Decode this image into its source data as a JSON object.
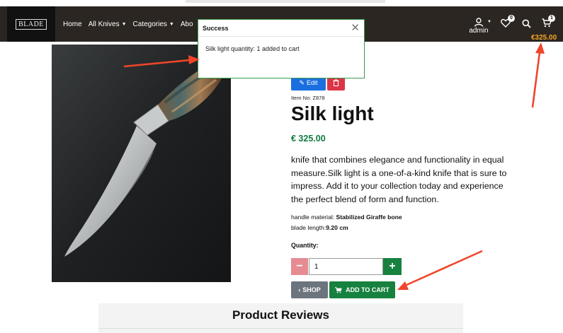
{
  "nav": {
    "logo": "BLADE",
    "links": [
      {
        "label": "Home",
        "dropdown": false
      },
      {
        "label": "All Knives",
        "dropdown": true
      },
      {
        "label": "Categories",
        "dropdown": true
      },
      {
        "label": "Abo",
        "dropdown": false
      }
    ],
    "user_label": "admin",
    "wishlist_count": "0",
    "cart_count": "1",
    "cart_total": "€325.00"
  },
  "toast": {
    "title": "Success",
    "message": "Silk light quantity: 1 added to cart"
  },
  "product": {
    "edit_label": "Edit",
    "item_no": "Item No: Z878",
    "title": "Silk light",
    "price": "€ 325.00",
    "description": "knife that combines elegance and functionality in equal measure.Silk light is a one-of-a-kind knife that is sure to impress. Add it to your collection today and experience the perfect blend of form and function.",
    "specs": [
      {
        "label": "handle material: ",
        "value": "Stabilized Giraffe bone"
      },
      {
        "label": "blade length:",
        "value": "9.20 cm"
      }
    ],
    "quantity_label": "Quantity:",
    "quantity_value": "1",
    "shop_label": "SHOP",
    "add_to_cart_label": "ADD TO CART"
  },
  "reviews": {
    "title": "Product Reviews"
  },
  "colors": {
    "navbar": "#2b2622",
    "accent_green": "#17813f",
    "price_green": "#0f7a3e",
    "cart_total": "#f5a623",
    "annotation_arrow": "#f0452a"
  }
}
